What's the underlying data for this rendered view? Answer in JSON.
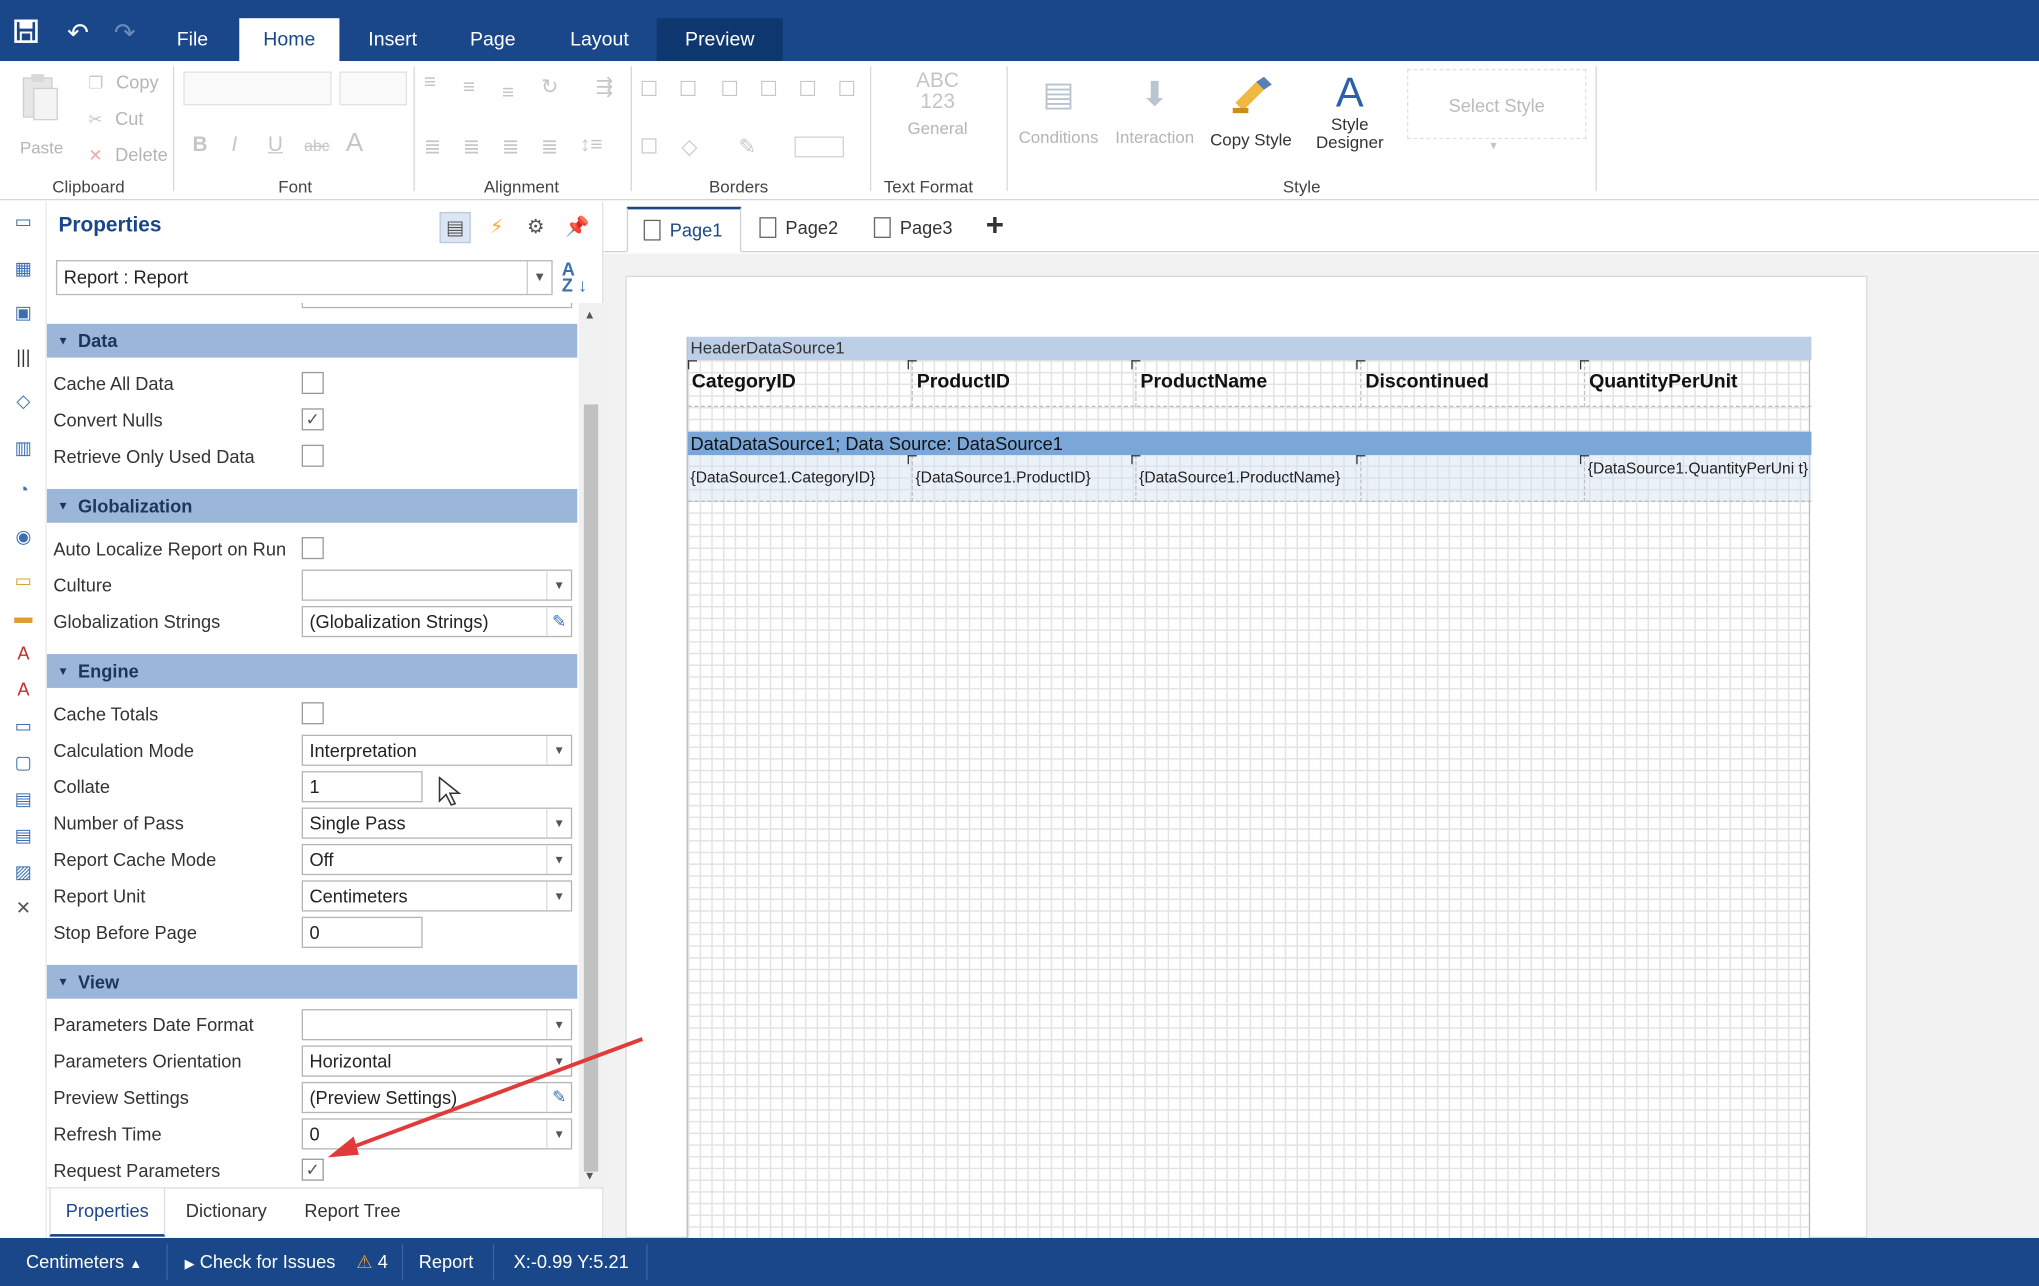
{
  "titlebar": {
    "tabs": [
      {
        "label": "File"
      },
      {
        "label": "Home"
      },
      {
        "label": "Insert"
      },
      {
        "label": "Page"
      },
      {
        "label": "Layout"
      },
      {
        "label": "Preview"
      }
    ]
  },
  "ribbon": {
    "clipboard": {
      "paste": "Paste",
      "copy": "Copy",
      "cut": "Cut",
      "delete": "Delete",
      "label": "Clipboard"
    },
    "font": {
      "label": "Font"
    },
    "alignment": {
      "label": "Alignment"
    },
    "borders": {
      "label": "Borders"
    },
    "text_format": {
      "icon_text_1": "ABC",
      "icon_text_2": "123",
      "general": "General",
      "label": "Text Format"
    },
    "style": {
      "conditions": "Conditions",
      "interaction": "Interaction",
      "copy_style": "Copy Style",
      "style_designer_1": "Style",
      "style_designer_2": "Designer",
      "select_style": "Select Style",
      "label": "Style"
    }
  },
  "properties": {
    "title": "Properties",
    "object": "Report : Report",
    "sort_icon": "A\nZ",
    "categories": {
      "data": "Data",
      "globalization": "Globalization",
      "engine": "Engine",
      "view": "View"
    },
    "rows": {
      "cache_all_data": "Cache All Data",
      "convert_nulls": "Convert Nulls",
      "retrieve_only": "Retrieve Only Used Data",
      "auto_localize": "Auto Localize Report on Run",
      "culture": "Culture",
      "culture_value": "",
      "glob_strings": "Globalization Strings",
      "glob_strings_value": "(Globalization Strings)",
      "cache_totals": "Cache Totals",
      "calc_mode": "Calculation Mode",
      "calc_mode_value": "Interpretation",
      "collate": "Collate",
      "collate_value": "1",
      "num_pass": "Number of Pass",
      "num_pass_value": "Single Pass",
      "cache_mode": "Report Cache Mode",
      "cache_mode_value": "Off",
      "report_unit": "Report Unit",
      "report_unit_value": "Centimeters",
      "stop_before": "Stop Before Page",
      "stop_before_value": "0",
      "param_date": "Parameters Date Format",
      "param_date_value": "",
      "param_orient": "Parameters Orientation",
      "param_orient_value": "Horizontal",
      "preview_settings": "Preview Settings",
      "preview_settings_value": "(Preview Settings)",
      "refresh_time": "Refresh Time",
      "refresh_time_value": "0",
      "request_params": "Request Parameters"
    },
    "checks": {
      "cache_all_data": false,
      "convert_nulls": true,
      "retrieve_only": false,
      "auto_localize": false,
      "cache_totals": false,
      "request_params": true
    },
    "bottom_tabs": [
      "Properties",
      "Dictionary",
      "Report Tree"
    ]
  },
  "pages": {
    "tabs": [
      "Page1",
      "Page2",
      "Page3"
    ],
    "add": "+"
  },
  "report": {
    "header_band": "HeaderDataSource1",
    "header_cells": [
      "CategoryID",
      "ProductID",
      "ProductName",
      "Discontinued",
      "QuantityPerUnit"
    ],
    "data_band": "DataDataSource1; Data Source: DataSource1",
    "data_cells": [
      "{DataSource1.CategoryID}",
      "{DataSource1.ProductID}",
      "{DataSource1.ProductName}",
      "",
      "{DataSource1.QuantityPerUni t}"
    ]
  },
  "status": {
    "units": "Centimeters",
    "check_issues": "Check for Issues",
    "issues_count": "4",
    "report": "Report",
    "coords": "X:-0.99 Y:5.21"
  },
  "colors": {
    "brand": "#19478a",
    "category": "#9bb6d8",
    "data_band": "#7aa6d8",
    "header_band": "#bccfe6",
    "annotation_arrow": "#e03a3a",
    "warning": "#f0a030"
  }
}
